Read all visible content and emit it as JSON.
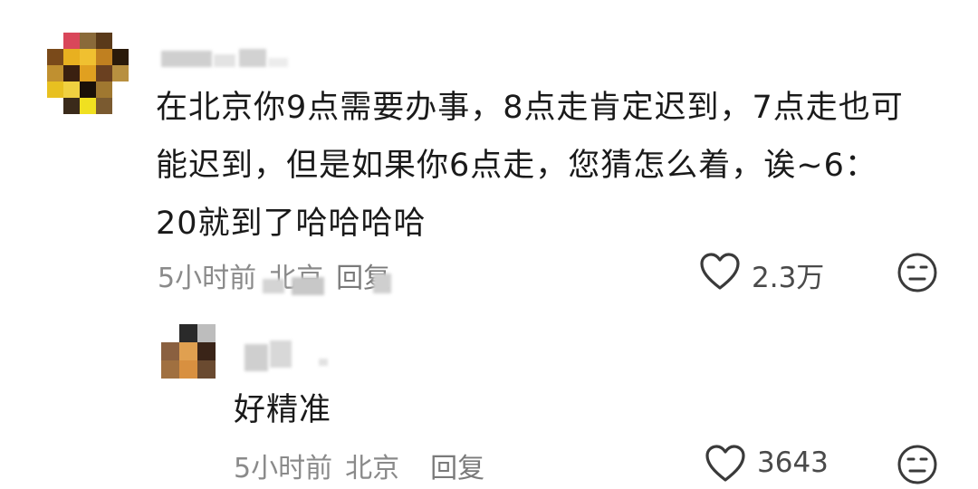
{
  "comment": {
    "text_lines": [
      "在北京你9点需要办事，8点走肯定迟到，7点走也可",
      "能迟到，但是如果你6点走，您猜怎么着，诶~6：",
      "20就到了哈哈哈哈"
    ],
    "time": "5小时前",
    "location": "北京",
    "reply_label": "回复",
    "like_count": "2.3万",
    "like_icon": "heart-outline-icon",
    "dislike_icon": "neutral-face-icon"
  },
  "reply": {
    "text": "好精准",
    "time": "5小时前",
    "location": "北京",
    "reply_label": "回复",
    "like_count": "3643",
    "like_icon": "heart-outline-icon",
    "dislike_icon": "neutral-face-icon"
  },
  "colors": {
    "text": "#1a1a1a",
    "meta": "#8a8a8a",
    "icon": "#3a3a3a"
  }
}
